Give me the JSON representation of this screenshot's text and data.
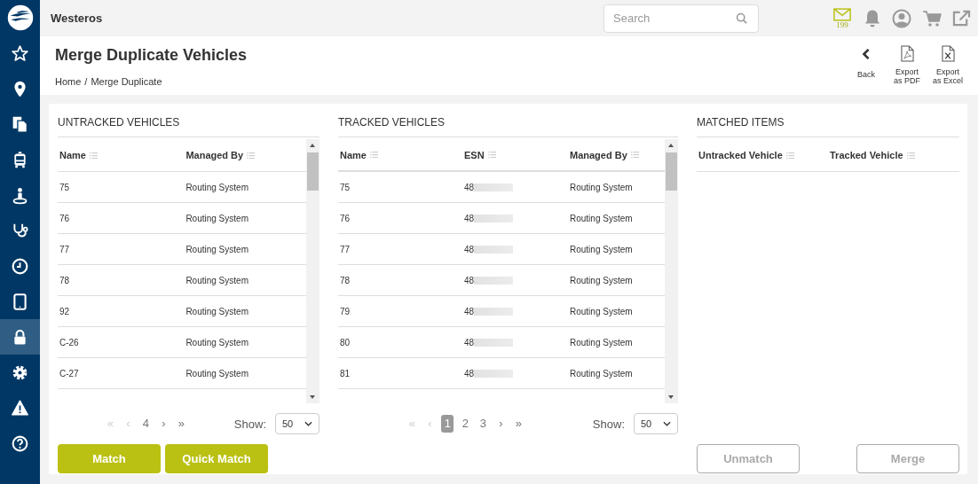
{
  "sidebar": {
    "items": [
      {
        "kind": "star",
        "selected": false
      },
      {
        "kind": "pin",
        "selected": false
      },
      {
        "kind": "documents",
        "selected": false
      },
      {
        "kind": "bus",
        "selected": false
      },
      {
        "kind": "person",
        "selected": false
      },
      {
        "kind": "stethoscope",
        "selected": false
      },
      {
        "kind": "clock",
        "selected": false
      },
      {
        "kind": "tablet",
        "selected": false
      },
      {
        "kind": "lock",
        "selected": true
      },
      {
        "kind": "gear",
        "selected": false
      },
      {
        "kind": "warning",
        "selected": false
      },
      {
        "kind": "help",
        "selected": false
      }
    ]
  },
  "topbar": {
    "title": "Westeros",
    "search": {
      "placeholder": "Search"
    },
    "mail_count": "199"
  },
  "header": {
    "title": "Merge Duplicate Vehicles",
    "breadcrumb": [
      "Home",
      "Merge Duplicate"
    ],
    "breadcrumb_separator": "/",
    "actions": [
      {
        "kind": "back",
        "label": "Back"
      },
      {
        "kind": "pdf",
        "label": "Export as PDF"
      },
      {
        "kind": "excel",
        "label": "Export as Excel"
      }
    ]
  },
  "panels": [
    {
      "title": "UNTRACKED VEHICLES",
      "columns": [
        "Name",
        "Managed By"
      ],
      "rows": [
        [
          "75",
          "Routing System"
        ],
        [
          "76",
          "Routing System"
        ],
        [
          "77",
          "Routing System"
        ],
        [
          "78",
          "Routing System"
        ],
        [
          "92",
          "Routing System"
        ],
        [
          "C-26",
          "Routing System"
        ],
        [
          "C-27",
          "Routing System"
        ]
      ],
      "pager": {
        "items": [
          {
            "kind": "nav",
            "label": "«",
            "disabled": true
          },
          {
            "kind": "nav",
            "label": "‹",
            "disabled": true
          },
          {
            "kind": "page",
            "label": "4",
            "selected": false
          },
          {
            "kind": "nav",
            "label": "›",
            "disabled": false
          },
          {
            "kind": "nav",
            "label": "»",
            "disabled": false
          }
        ],
        "show_label": "Show:",
        "page_size": "50"
      },
      "buttons": [
        {
          "label": "Match",
          "disabled": false
        },
        {
          "label": "Quick Match",
          "disabled": false
        }
      ]
    },
    {
      "title": "TRACKED VEHICLES",
      "columns": [
        "Name",
        "ESN",
        "Managed By"
      ],
      "rows": [
        [
          "75",
          "48",
          "Routing System"
        ],
        [
          "76",
          "48",
          "Routing System"
        ],
        [
          "77",
          "48",
          "Routing System"
        ],
        [
          "78",
          "48",
          "Routing System"
        ],
        [
          "79",
          "48",
          "Routing System"
        ],
        [
          "80",
          "48",
          "Routing System"
        ],
        [
          "81",
          "48",
          "Routing System"
        ]
      ],
      "pager": {
        "items": [
          {
            "kind": "nav",
            "label": "«",
            "disabled": true
          },
          {
            "kind": "nav",
            "label": "‹",
            "disabled": true
          },
          {
            "kind": "page",
            "label": "1",
            "selected": true
          },
          {
            "kind": "page",
            "label": "2",
            "selected": false
          },
          {
            "kind": "page",
            "label": "3",
            "selected": false
          },
          {
            "kind": "nav",
            "label": "›",
            "disabled": false
          },
          {
            "kind": "nav",
            "label": "»",
            "disabled": false
          }
        ],
        "show_label": "Show:",
        "page_size": "50"
      }
    },
    {
      "title": "MATCHED ITEMS",
      "columns": [
        "Untracked Vehicle",
        "Tracked Vehicle"
      ],
      "buttons": [
        {
          "label": "Unmatch",
          "disabled": true
        },
        {
          "label": "Merge",
          "disabled": true
        }
      ]
    }
  ]
}
